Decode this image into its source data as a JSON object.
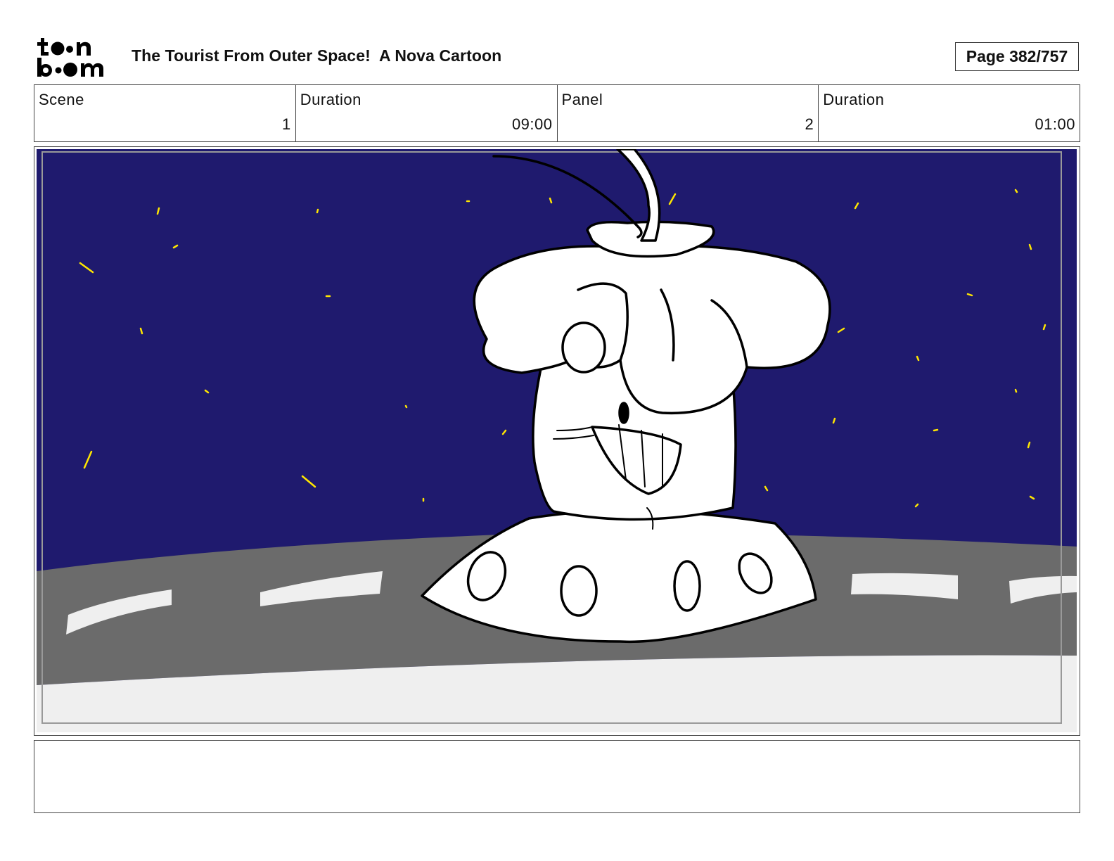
{
  "header": {
    "logo": "toon boom logo",
    "title": "The Tourist From Outer Space!  A Nova Cartoon",
    "page": "Page 382/757"
  },
  "info": {
    "scene_label": "Scene",
    "scene_value": "1",
    "scene_duration_label": "Duration",
    "scene_duration_value": "09:00",
    "panel_label": "Panel",
    "panel_value": "2",
    "panel_duration_label": "Duration",
    "panel_duration_value": "01:00"
  },
  "panel": {
    "sky_color": "#1f1a6e",
    "star_color": "#ffe600",
    "road_color": "#6b6b6b",
    "ground_color": "#efefef"
  },
  "notes": {
    "text": ""
  }
}
